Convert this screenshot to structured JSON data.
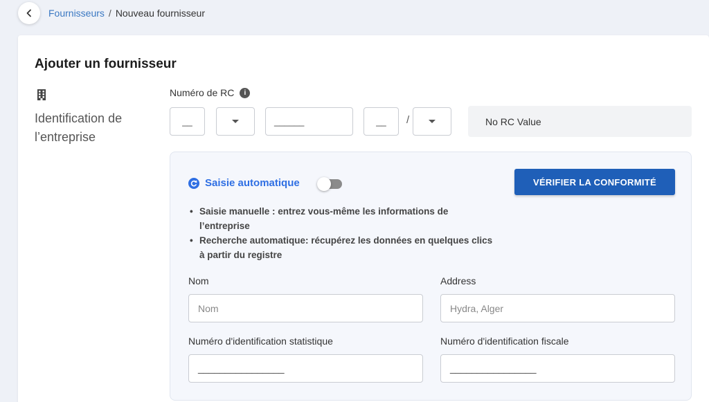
{
  "breadcrumb": {
    "parent": "Fournisseurs",
    "separator": "/",
    "current": "Nouveau fournisseur"
  },
  "icons": {
    "back": "chevron-left-icon",
    "building": "building-icon",
    "info": "info-icon",
    "auto": "refresh-icon"
  },
  "colors": {
    "accent": "#2f6fe3",
    "button": "#1f5fb8",
    "link": "#3a78c2",
    "page_bg": "#eef1f7",
    "panel_bg": "#f5f7fc"
  },
  "form": {
    "title": "Ajouter un fournisseur",
    "section_label": "Identification de l’entreprise",
    "rc": {
      "label": "Numéro de RC",
      "box1": "__",
      "box3": "______",
      "box4": "__",
      "slash": "/",
      "value": "No RC Value"
    },
    "auto": {
      "label": "Saisie automatique",
      "enabled": false,
      "verify_button": "VÉRIFIER LA CONFORMITÉ",
      "bullets": [
        "Saisie manuelle : entrez vous-même les informations de l’entreprise",
        "Recherche automatique: récupérez les données en quelques clics à partir du registre"
      ]
    },
    "fields": {
      "nom": {
        "label": "Nom",
        "placeholder": "Nom"
      },
      "address": {
        "label": "Address",
        "placeholder": "Hydra, Alger"
      },
      "nis": {
        "label": "Numéro d'identification statistique",
        "value": "________________"
      },
      "nif": {
        "label": "Numéro d'identification fiscale",
        "value": "________________"
      }
    }
  }
}
